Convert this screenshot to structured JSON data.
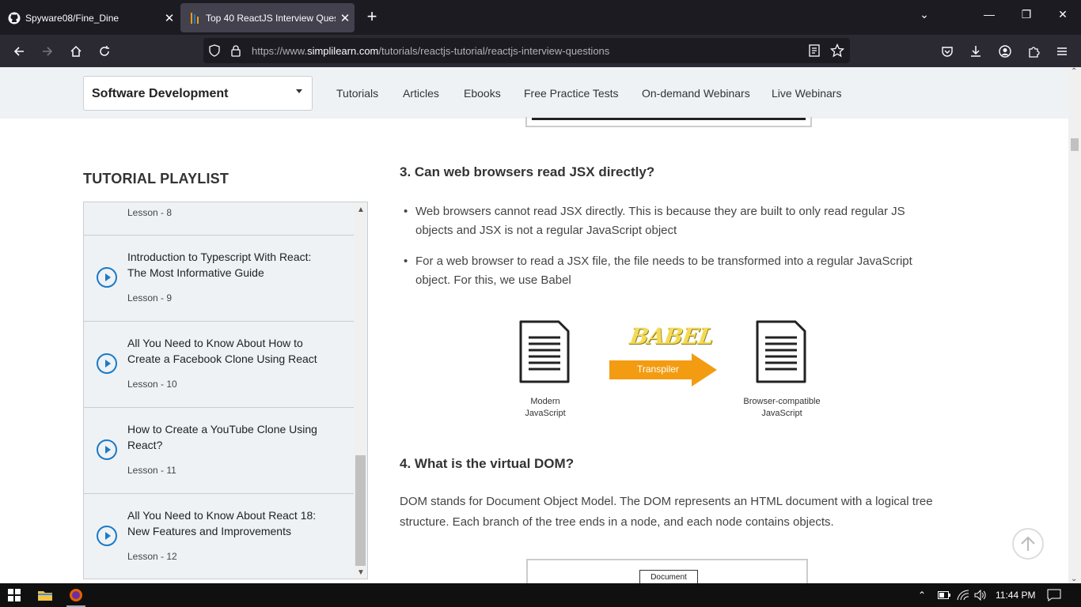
{
  "browser": {
    "tabs": [
      {
        "title": "Spyware08/Fine_Dine",
        "icon": "github-icon"
      },
      {
        "title": "Top 40 ReactJS Interview Questi",
        "icon": "simplilearn-icon",
        "active": true
      }
    ],
    "url_prefix": "https://www.",
    "url_domain": "simplilearn.com",
    "url_path": "/tutorials/reactjs-tutorial/reactjs-interview-questions"
  },
  "subnav": {
    "category": "Software Development",
    "links": [
      "Tutorials",
      "Articles",
      "Ebooks",
      "Free Practice Tests",
      "On-demand Webinars",
      "Live Webinars"
    ]
  },
  "playlist": {
    "title": "TUTORIAL PLAYLIST",
    "partial_lesson": "Lesson - 8",
    "items": [
      {
        "title": "Introduction to Typescript With React: The Most Informative Guide",
        "lesson": "Lesson - 9"
      },
      {
        "title": "All You Need to Know About How to Create a Facebook Clone Using React",
        "lesson": "Lesson - 10"
      },
      {
        "title": "How to Create a YouTube Clone Using React?",
        "lesson": "Lesson - 11"
      },
      {
        "title": "All You Need to Know About React 18: New Features and Improvements",
        "lesson": "Lesson - 12"
      }
    ]
  },
  "article": {
    "q3_heading": "3. Can web browsers read JSX directly?",
    "q3_bullets": [
      "Web browsers cannot read JSX directly. This is because they are built to only read regular JS objects and JSX is not a regular JavaScript object",
      "For a web browser to read a JSX file, the file needs to be transformed into a regular JavaScript object. For this, we use Babel"
    ],
    "diagram": {
      "left_label_line1": "Modern",
      "left_label_line2": "JavaScript",
      "logo_text": "BABEL",
      "arrow_label": "Transpiler",
      "right_label_line1": "Browser-compatible",
      "right_label_line2": "JavaScript"
    },
    "q4_heading": "4. What is the virtual DOM?",
    "q4_paragraph": "DOM stands for Document Object Model. The DOM represents an HTML document with a logical tree structure. Each branch of the tree ends in a node, and each node contains objects.",
    "dom_box_label": "Document"
  },
  "taskbar": {
    "time": "11:44 PM"
  },
  "colors": {
    "accent_blue": "#1b7ac7",
    "arrow_orange": "#f39c12"
  }
}
